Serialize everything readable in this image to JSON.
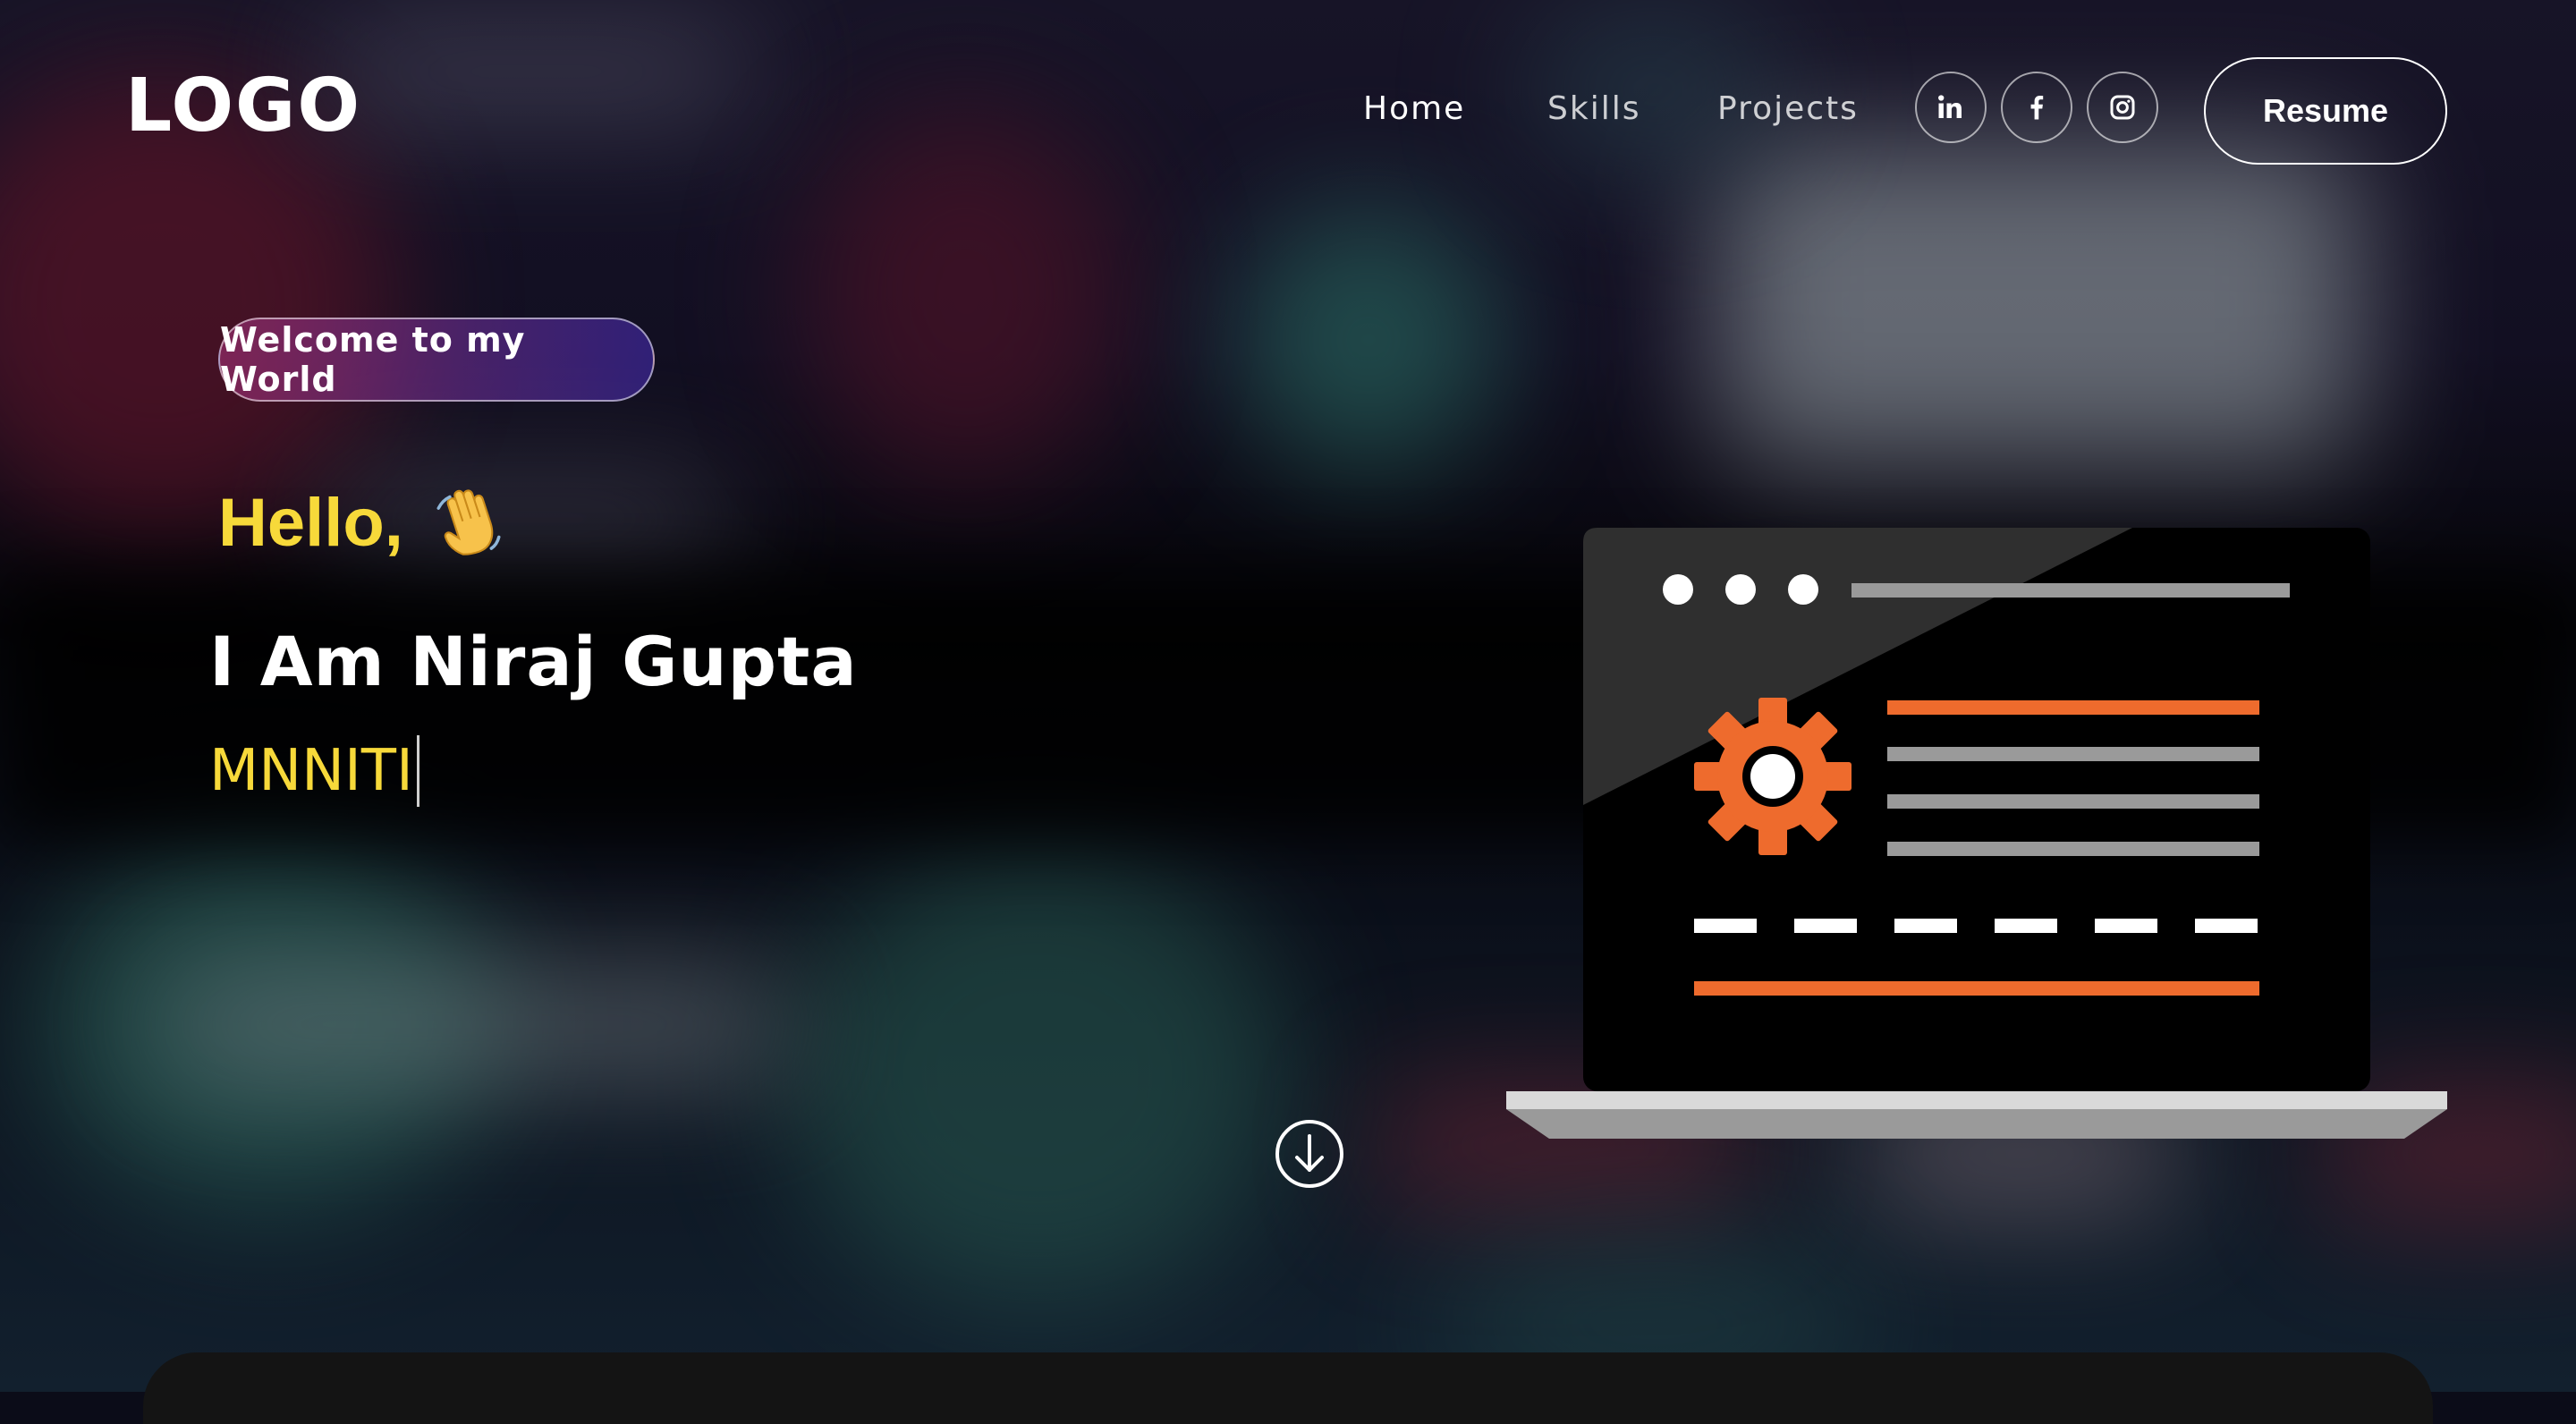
{
  "header": {
    "logo": "LOGO",
    "nav": [
      {
        "label": "Home"
      },
      {
        "label": "Skills"
      },
      {
        "label": "Projects"
      }
    ],
    "social_icons": [
      "linkedin-icon",
      "facebook-icon",
      "instagram-icon"
    ],
    "resume_label": "Resume"
  },
  "hero": {
    "badge": "Welcome to my World",
    "greeting": "Hello,",
    "greeting_icon": "waving-hand-icon",
    "name": "I Am Niraj Gupta",
    "typed_text": "MNNITI"
  },
  "scroll_icon": "arrow-down-circle-icon",
  "illustration": "laptop-settings-illustration",
  "colors": {
    "accent_yellow": "#f7d93a",
    "accent_orange": "#ee6b2d",
    "badge_gradient_start": "#aa367c",
    "badge_gradient_end": "#4a2fbd"
  }
}
